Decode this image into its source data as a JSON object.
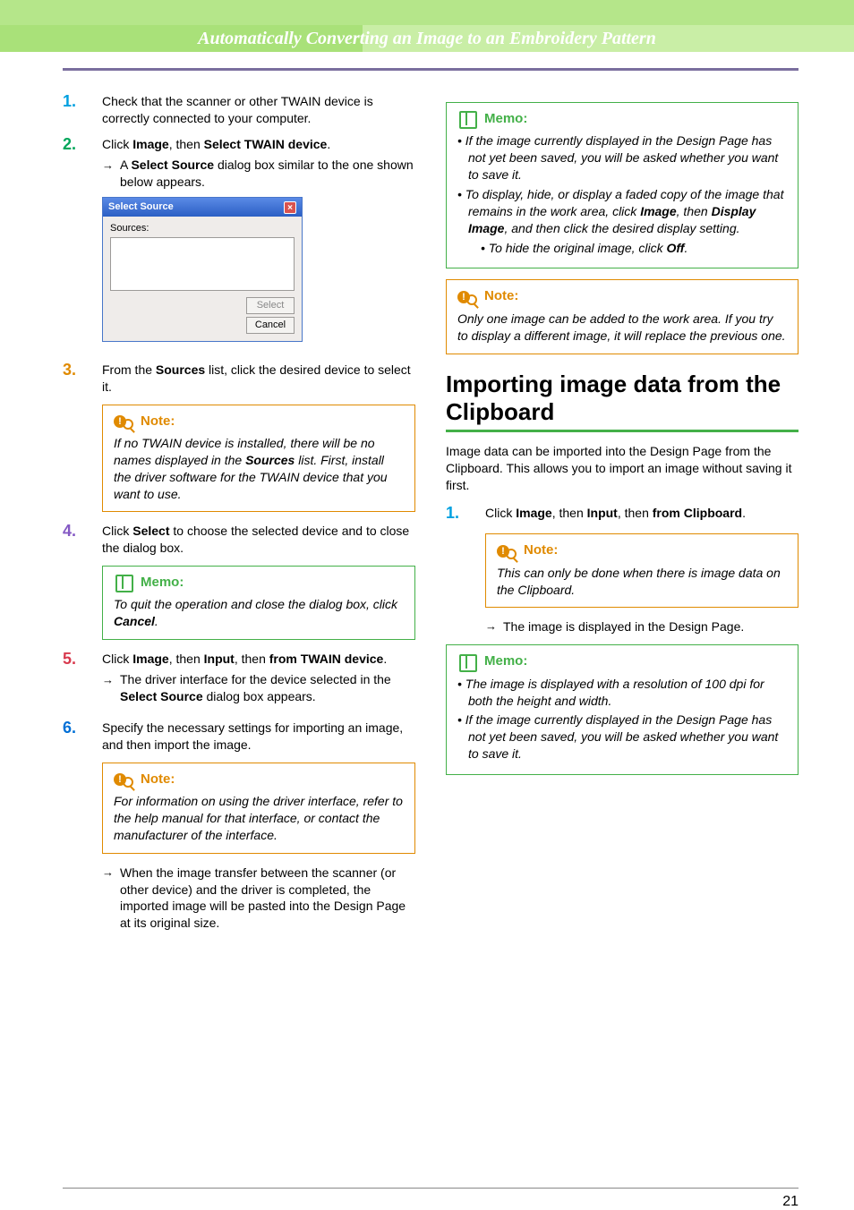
{
  "header": {
    "title": "Automatically Converting an Image to an Embroidery Pattern"
  },
  "left": {
    "steps": {
      "s1": {
        "num": "1.",
        "text": "Check that the scanner or other TWAIN device is correctly connected to your computer."
      },
      "s2": {
        "num": "2.",
        "text_pre": "Click ",
        "b1": "Image",
        "mid": ", then ",
        "b2": "Select TWAIN device",
        "post": ".",
        "sub_pre": "A ",
        "sub_b": "Select Source",
        "sub_post": " dialog box similar to the one shown below appears."
      },
      "dialog": {
        "title": "Select Source",
        "label": "Sources:",
        "btn_select": "Select",
        "btn_cancel": "Cancel"
      },
      "s3": {
        "num": "3.",
        "pre": "From the ",
        "b": "Sources",
        "post": " list, click the desired device to select it."
      },
      "note1": {
        "head": "Note:",
        "pre": "If no TWAIN device is installed, there will be no names displayed in the ",
        "b": "Sources",
        "post": " list. First, install the driver software for the TWAIN device that you want to use."
      },
      "s4": {
        "num": "4.",
        "pre": "Click ",
        "b": "Select",
        "post": " to choose the selected device and to close the dialog box."
      },
      "memo1": {
        "head": "Memo:",
        "pre": "To quit the operation and close the dialog box, click ",
        "b": "Cancel",
        "post": "."
      },
      "s5": {
        "num": "5.",
        "pre": "Click ",
        "b1": "Image",
        "m1": ", then ",
        "b2": "Input",
        "m2": ", then ",
        "b3": "from TWAIN device",
        "post": ".",
        "sub_pre": "The driver interface for the device selected in the ",
        "sub_b": "Select Source",
        "sub_post": " dialog box appears."
      },
      "s6": {
        "num": "6.",
        "text": "Specify the necessary settings for importing an image, and then import the image."
      },
      "note2": {
        "head": "Note:",
        "text": "For information on using the driver interface, refer to the help manual for that interface, or contact the manufacturer of the interface."
      },
      "s6sub": "When the image transfer between the scanner (or other device) and the driver is completed, the imported image will be pasted into the Design Page at its original size."
    }
  },
  "right": {
    "memo_top": {
      "head": "Memo:",
      "li1": "If the image currently displayed in the Design Page has not yet been saved, you will be asked whether you want to save it.",
      "li2_pre": "To display, hide, or display a faded copy of the image that remains in the work area, click ",
      "li2_b1": "Image",
      "li2_m": ", then ",
      "li2_b2": "Display Image",
      "li2_post": ", and then click the desired display setting.",
      "li2a_pre": "To hide the original image, click ",
      "li2a_b": "Off",
      "li2a_post": "."
    },
    "note_top": {
      "head": "Note:",
      "text": "Only one image can be added to the work area. If you try to display a different image, it will replace the previous one."
    },
    "section": "Importing image data from the Clipboard",
    "intro": "Image data can be imported into the Design Page from the Clipboard. This allows you to import an image without saving it first.",
    "s1": {
      "num": "1.",
      "pre": "Click ",
      "b1": "Image",
      "m1": ", then ",
      "b2": "Input",
      "m2": ", then ",
      "b3": "from Clipboard",
      "post": "."
    },
    "note1": {
      "head": "Note:",
      "text": "This can only be done when there is image data on the Clipboard."
    },
    "sub": "The image is displayed in the Design Page.",
    "memo_bot": {
      "head": "Memo:",
      "li1": "The image is displayed with a resolution of 100 dpi for both the height and width.",
      "li2": "If the image currently displayed in the Design Page has not yet been saved, you will be asked whether you want to save it."
    }
  },
  "page_number": "21"
}
